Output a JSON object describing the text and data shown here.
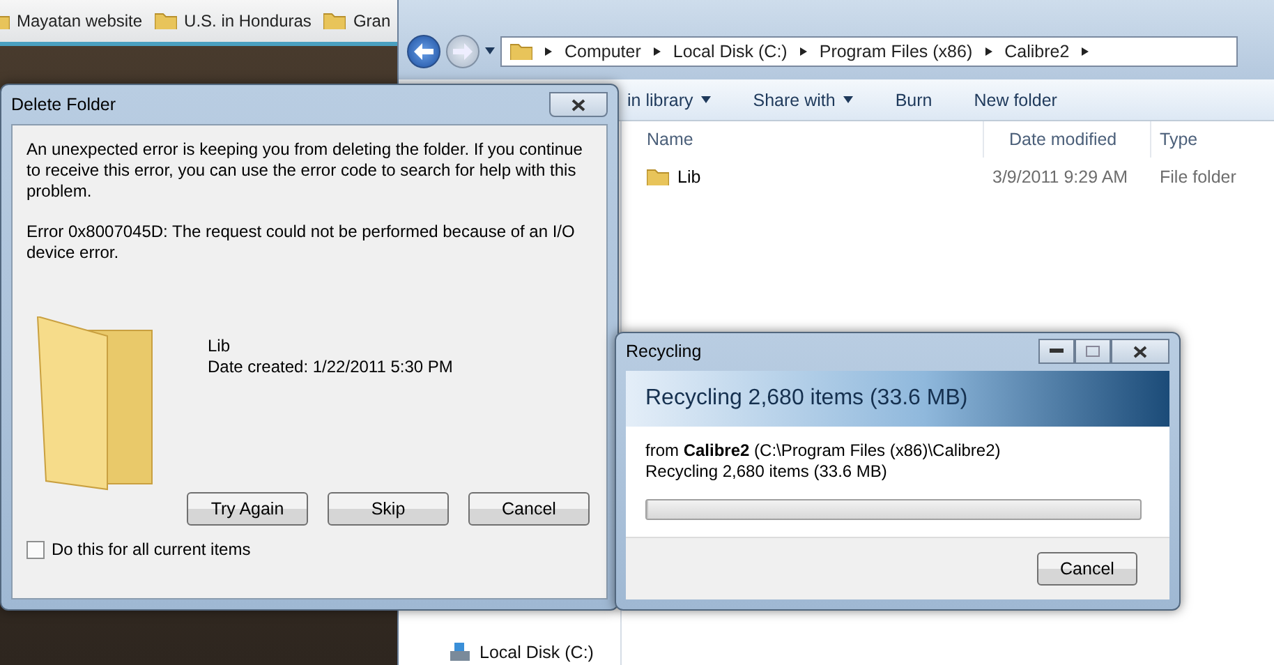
{
  "browser": {
    "bookmarks": [
      "Mayatan website",
      "U.S. in Honduras",
      "Gran"
    ]
  },
  "explorer": {
    "breadcrumbs": [
      "Computer",
      "Local Disk (C:)",
      "Program Files (x86)",
      "Calibre2"
    ],
    "toolbar": [
      {
        "label": "in library",
        "dropdown": true
      },
      {
        "label": "Share with",
        "dropdown": true
      },
      {
        "label": "Burn",
        "dropdown": false
      },
      {
        "label": "New folder",
        "dropdown": false
      }
    ],
    "columns": [
      "Name",
      "Date modified",
      "Type"
    ],
    "rows": [
      {
        "name": "Lib",
        "date": "3/9/2011 9:29 AM",
        "type": "File folder"
      }
    ],
    "nav_items": [
      "Local Disk (C:)"
    ]
  },
  "delete_dialog": {
    "title": "Delete Folder",
    "message": "An unexpected error is keeping you from deleting the folder. If you continue to receive this error, you can use the error code to search for help with this problem.",
    "error": "Error 0x8007045D: The request could not be performed because of an I/O device error.",
    "item_name": "Lib",
    "item_date": "Date created: 1/22/2011 5:30 PM",
    "buttons": [
      "Try Again",
      "Skip",
      "Cancel"
    ],
    "checkbox": {
      "label": "Do this for all current items",
      "checked": false
    }
  },
  "recycling_dialog": {
    "title": "Recycling",
    "heading": "Recycling 2,680 items (33.6 MB)",
    "source": "from **Calibre2** (C:\\Program Files (x86)\\Calibre2)",
    "status": "Recycling 2,680 items (33.6 MB)",
    "progress": {
      "level": 0
    },
    "button": "Cancel"
  }
}
